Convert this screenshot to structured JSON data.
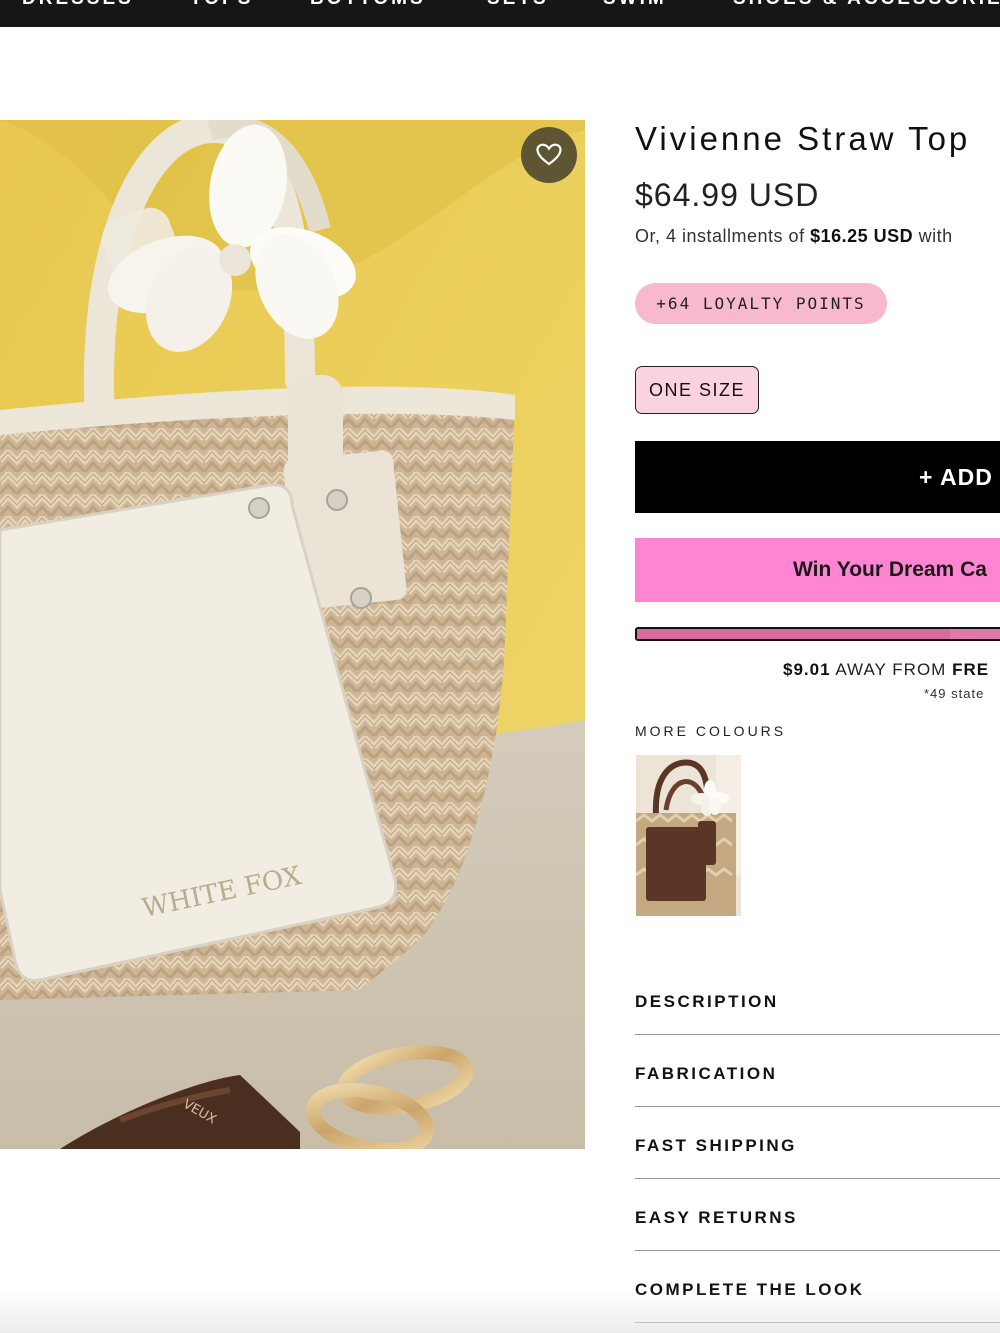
{
  "nav": {
    "items": [
      "DRESSES",
      "TOPS",
      "BOTTOMS",
      "SETS",
      "SWIM",
      "SHOES & ACCESSORIES"
    ]
  },
  "product": {
    "title": "Vivienne Straw Top",
    "price": "$64.99 USD",
    "installments_prefix": "Or, 4 installments of ",
    "installments_amount": "$16.25 USD",
    "installments_suffix": " with",
    "loyalty": "+64 LOYALTY POINTS",
    "size": "ONE SIZE",
    "add_label": "+ ADD T",
    "win_label": "Win Your Dream Ca",
    "shipping_amount": "$9.01",
    "shipping_middle": " AWAY FROM ",
    "shipping_free": "FRE",
    "shipping_note": "*49 state",
    "shipping_progress": 0.85,
    "more_colours_label": "MORE COLOURS"
  },
  "photo": {
    "brand_plate_text": "WHITE FOX",
    "sunglasses_text": "VEUX"
  },
  "accordion": [
    "DESCRIPTION",
    "FABRICATION",
    "FAST SHIPPING",
    "EASY RETURNS",
    "COMPLETE THE LOOK"
  ],
  "colors": {
    "nav_bg": "#161616",
    "loyalty_pill": "#f8b9cc",
    "size_selected": "#fbd3df",
    "add_button": "#000000",
    "win_button": "#ff85d2",
    "progress": "#e07aa8"
  },
  "icons": {
    "wishlist": "heart-outline-icon"
  }
}
